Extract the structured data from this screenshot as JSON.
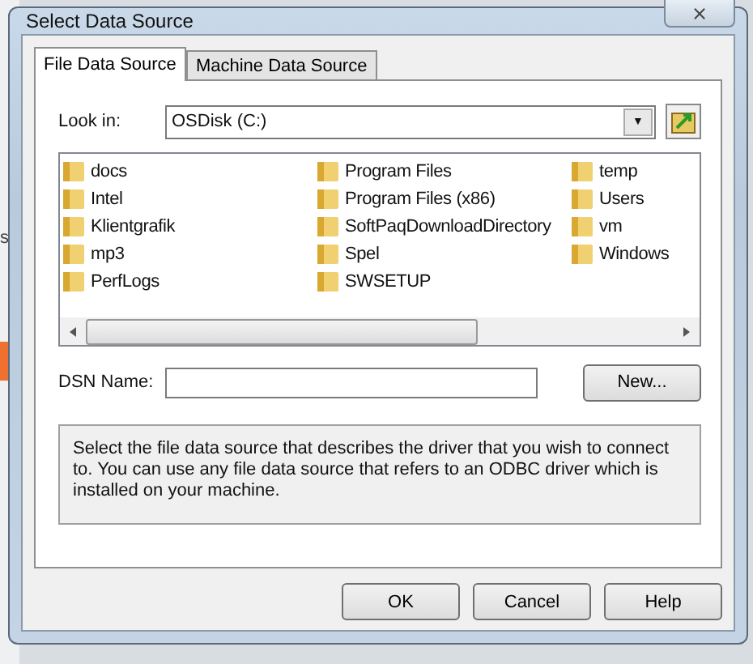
{
  "background_window": {
    "text": "s"
  },
  "window": {
    "title": "Select Data Source",
    "close": "⨯"
  },
  "tabs": [
    {
      "label": "File Data Source",
      "selected": true
    },
    {
      "label": "Machine Data Source",
      "selected": false
    }
  ],
  "look_in": {
    "label": "Look in:",
    "value": "OSDisk (C:)",
    "dropdown_arrow": "▼"
  },
  "folders": [
    {
      "name": "docs"
    },
    {
      "name": "Intel"
    },
    {
      "name": "Klientgrafik"
    },
    {
      "name": "mp3"
    },
    {
      "name": "PerfLogs"
    },
    {
      "name": "Program Files"
    },
    {
      "name": "Program Files (x86)"
    },
    {
      "name": "SoftPaqDownloadDirectory"
    },
    {
      "name": "Spel"
    },
    {
      "name": "SWSETUP"
    },
    {
      "name": "temp"
    },
    {
      "name": "Users"
    },
    {
      "name": "vm"
    },
    {
      "name": "Windows"
    }
  ],
  "dsn": {
    "label": "DSN Name:",
    "button": "New..."
  },
  "description": "Select the file data source that describes the driver that you wish to connect to. You can use any file data source that refers to an ODBC driver which is installed on your machine.",
  "buttons": [
    "OK",
    "Cancel",
    "Help"
  ]
}
